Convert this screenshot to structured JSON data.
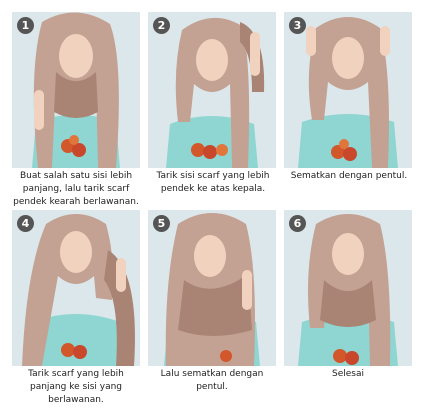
{
  "steps": [
    {
      "number": "1",
      "caption": "Buat salah satu sisi  lebih panjang, lalu tarik scarf pendek kearah berlawanan."
    },
    {
      "number": "2",
      "caption": "Tarik sisi  scarf yang lebih pendek ke atas kepala."
    },
    {
      "number": "3",
      "caption": "Sematkan dengan pentul."
    },
    {
      "number": "4",
      "caption": "Tarik scarf yang lebih panjang ke sisi yang berlawanan."
    },
    {
      "number": "5",
      "caption": "Lalu sematkan dengan pentul."
    },
    {
      "number": "6",
      "caption": "Selesai"
    }
  ],
  "colors": {
    "hijab": "#c4a293",
    "hijab_shadow": "#a98373",
    "shirt": "#8fd6d2",
    "skin": "#f1d2bf",
    "background": "#dbe7ea",
    "badge": "#555555",
    "flower": "#d2572b"
  }
}
